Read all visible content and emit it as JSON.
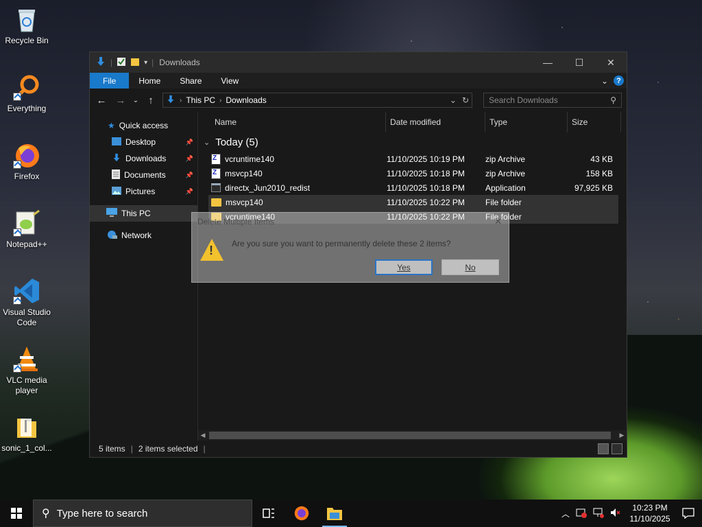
{
  "desktop": {
    "icons": [
      {
        "label": "Recycle Bin",
        "icon": "recycle-bin-icon"
      },
      {
        "label": "Everything",
        "icon": "everything-icon"
      },
      {
        "label": "Firefox",
        "icon": "firefox-icon"
      },
      {
        "label": "Notepad++",
        "icon": "notepad-plus-plus-icon"
      },
      {
        "label": "Visual Studio Code",
        "icon": "vscode-icon"
      },
      {
        "label": "VLC media player",
        "icon": "vlc-icon"
      },
      {
        "label": "sonic_1_col...",
        "icon": "folder-zip-icon"
      }
    ]
  },
  "window": {
    "title": "Downloads",
    "ribbon_tabs": [
      "File",
      "Home",
      "Share",
      "View"
    ],
    "breadcrumb": [
      "This PC",
      "Downloads"
    ],
    "search_placeholder": "Search Downloads",
    "nav": {
      "quick_access": "Quick access",
      "items": [
        {
          "label": "Desktop",
          "icon": "desktop-folder-icon",
          "pinned": true
        },
        {
          "label": "Downloads",
          "icon": "download-arrow-icon",
          "pinned": true
        },
        {
          "label": "Documents",
          "icon": "documents-icon",
          "pinned": true
        },
        {
          "label": "Pictures",
          "icon": "pictures-icon",
          "pinned": true
        }
      ],
      "this_pc": "This PC",
      "network": "Network"
    },
    "columns": [
      "Name",
      "Date modified",
      "Type",
      "Size"
    ],
    "group_label": "Today (5)",
    "files": [
      {
        "name": "vcruntime140",
        "date": "11/10/2025 10:19 PM",
        "type": "zip Archive",
        "size": "43 KB",
        "icon": "zip-icon",
        "selected": false
      },
      {
        "name": "msvcp140",
        "date": "11/10/2025 10:18 PM",
        "type": "zip Archive",
        "size": "158 KB",
        "icon": "zip-icon",
        "selected": false
      },
      {
        "name": "directx_Jun2010_redist",
        "date": "11/10/2025 10:18 PM",
        "type": "Application",
        "size": "97,925 KB",
        "icon": "application-icon",
        "selected": false
      },
      {
        "name": "msvcp140",
        "date": "11/10/2025 10:22 PM",
        "type": "File folder",
        "size": "",
        "icon": "folder-icon",
        "selected": true
      },
      {
        "name": "vcruntime140",
        "date": "11/10/2025 10:22 PM",
        "type": "File folder",
        "size": "",
        "icon": "folder-icon",
        "selected": true
      }
    ],
    "status": {
      "items": "5 items",
      "selected": "2 items selected"
    }
  },
  "dialog": {
    "title": "Delete Multiple Items",
    "message": "Are you sure you want to permanently delete these 2 items?",
    "yes": "Yes",
    "no": "No"
  },
  "taskbar": {
    "search_placeholder": "Type here to search",
    "time": "10:23 PM",
    "date": "11/10/2025"
  },
  "colors": {
    "accent": "#1979ca",
    "folder": "#f5c542",
    "window_bg": "#191919",
    "selection": "#333333"
  }
}
